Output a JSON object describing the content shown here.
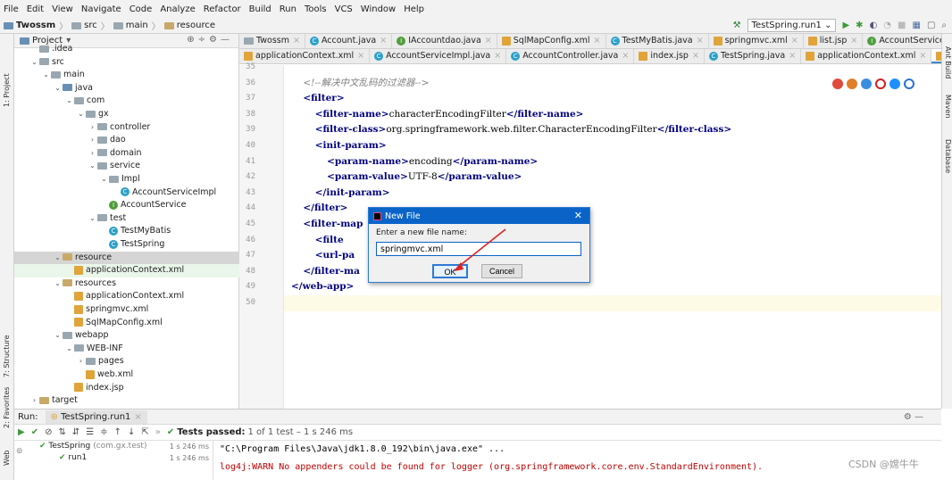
{
  "menu": [
    "File",
    "Edit",
    "View",
    "Navigate",
    "Code",
    "Analyze",
    "Refactor",
    "Build",
    "Run",
    "Tools",
    "VCS",
    "Window",
    "Help"
  ],
  "breadcrumb": [
    "Twossm",
    "src",
    "main",
    "resource"
  ],
  "run_config": "TestSpring.run1",
  "left_strip": {
    "project": "1: Project",
    "structure": "7: Structure",
    "favorites": "2: Favorites",
    "web": "Web"
  },
  "right_strip": {
    "ant": "Ant Build",
    "maven": "Maven",
    "database": "Database"
  },
  "project_panel_title": "Project",
  "tree": [
    {
      "label": ".idea",
      "depth": 1,
      "icon": "folder",
      "chev": ""
    },
    {
      "label": "src",
      "depth": 1,
      "icon": "folder",
      "chev": "v"
    },
    {
      "label": "main",
      "depth": 2,
      "icon": "folder",
      "chev": "v"
    },
    {
      "label": "java",
      "depth": 3,
      "icon": "folder-blue",
      "chev": "v"
    },
    {
      "label": "com",
      "depth": 4,
      "icon": "folder",
      "chev": "v"
    },
    {
      "label": "gx",
      "depth": 5,
      "icon": "folder",
      "chev": "v"
    },
    {
      "label": "controller",
      "depth": 6,
      "icon": "folder",
      "chev": ">"
    },
    {
      "label": "dao",
      "depth": 6,
      "icon": "folder",
      "chev": ">"
    },
    {
      "label": "domain",
      "depth": 6,
      "icon": "folder",
      "chev": ">"
    },
    {
      "label": "service",
      "depth": 6,
      "icon": "folder",
      "chev": "v"
    },
    {
      "label": "Impl",
      "depth": 7,
      "icon": "folder",
      "chev": "v"
    },
    {
      "label": "AccountServiceImpl",
      "depth": 8,
      "icon": "class",
      "chev": ""
    },
    {
      "label": "AccountService",
      "depth": 7,
      "icon": "interface",
      "chev": ""
    },
    {
      "label": "test",
      "depth": 6,
      "icon": "folder",
      "chev": "v"
    },
    {
      "label": "TestMyBatis",
      "depth": 7,
      "icon": "class",
      "chev": ""
    },
    {
      "label": "TestSpring",
      "depth": 7,
      "icon": "class",
      "chev": ""
    },
    {
      "label": "resource",
      "depth": 3,
      "icon": "folder-res",
      "chev": "v",
      "state": "sel"
    },
    {
      "label": "applicationContext.xml",
      "depth": 4,
      "icon": "xml",
      "chev": "",
      "state": "hl"
    },
    {
      "label": "resources",
      "depth": 3,
      "icon": "folder-res",
      "chev": "v"
    },
    {
      "label": "applicationContext.xml",
      "depth": 4,
      "icon": "xml",
      "chev": ""
    },
    {
      "label": "springmvc.xml",
      "depth": 4,
      "icon": "xml",
      "chev": ""
    },
    {
      "label": "SqlMapConfig.xml",
      "depth": 4,
      "icon": "xml",
      "chev": ""
    },
    {
      "label": "webapp",
      "depth": 3,
      "icon": "folder",
      "chev": "v"
    },
    {
      "label": "WEB-INF",
      "depth": 4,
      "icon": "folder",
      "chev": "v"
    },
    {
      "label": "pages",
      "depth": 5,
      "icon": "folder",
      "chev": ">"
    },
    {
      "label": "web.xml",
      "depth": 5,
      "icon": "xml",
      "chev": ""
    },
    {
      "label": "index.jsp",
      "depth": 4,
      "icon": "xml",
      "chev": ""
    },
    {
      "label": "target",
      "depth": 1,
      "icon": "folder-res",
      "chev": ">"
    }
  ],
  "tabs_row1": [
    "Twossm",
    "Account.java",
    "IAccountdao.java",
    "SqlMapConfig.xml",
    "TestMyBatis.java",
    "springmvc.xml",
    "list.jsp",
    "AccountService.java"
  ],
  "tabs_row2": [
    "applicationContext.xml",
    "AccountServiceImpl.java",
    "AccountController.java",
    "index.jsp",
    "TestSpring.java",
    "applicationContext.xml",
    "web.xml"
  ],
  "code_lines": [
    {
      "n": "35",
      "html": ""
    },
    {
      "n": "36",
      "html": "    <span class='cm'>&lt;!--解决中文乱码的过滤器--&gt;</span>"
    },
    {
      "n": "37",
      "html": "    <span class='tg'>&lt;filter&gt;</span>"
    },
    {
      "n": "38",
      "html": "        <span class='tg'>&lt;filter-name&gt;</span>characterEncodingFilter<span class='tg'>&lt;/filter-name&gt;</span>"
    },
    {
      "n": "39",
      "html": "        <span class='tg'>&lt;filter-class&gt;</span>org.springframework.web.filter.CharacterEncodingFilter<span class='tg'>&lt;/filter-class&gt;</span>"
    },
    {
      "n": "40",
      "html": "        <span class='tg'>&lt;init-param&gt;</span>"
    },
    {
      "n": "41",
      "html": "            <span class='tg'>&lt;param-name&gt;</span>encoding<span class='tg'>&lt;/param-name&gt;</span>"
    },
    {
      "n": "42",
      "html": "            <span class='tg'>&lt;param-value&gt;</span>UTF-8<span class='tg'>&lt;/param-value&gt;</span>"
    },
    {
      "n": "43",
      "html": "        <span class='tg'>&lt;/init-param&gt;</span>"
    },
    {
      "n": "44",
      "html": "    <span class='tg'>&lt;/filter&gt;</span>"
    },
    {
      "n": "45",
      "html": "    <span class='tg'>&lt;filter-map</span>"
    },
    {
      "n": "46",
      "html": "        <span class='tg'>&lt;filte</span>                                           <span class='tg'>me&gt;</span>"
    },
    {
      "n": "47",
      "html": "        <span class='tg'>&lt;url-pa</span>"
    },
    {
      "n": "48",
      "html": "    <span class='tg'>&lt;/filter-ma</span>"
    },
    {
      "n": "49",
      "html": "<span class='tg'>&lt;/web-app&gt;</span>"
    },
    {
      "n": "50",
      "html": ""
    }
  ],
  "dialog": {
    "title": "New File",
    "prompt": "Enter a new file name:",
    "value": "springmvc.xml",
    "ok": "OK",
    "cancel": "Cancel"
  },
  "run": {
    "label": "Run:",
    "tab": "TestSpring.run1",
    "status_bold": "Tests passed:",
    "status_rest": "1 of 1 test – 1 s 246 ms",
    "tree": [
      {
        "label": "TestSpring",
        "sub": "(com.gx.test)",
        "time": "1 s 246 ms"
      },
      {
        "label": "run1",
        "sub": "",
        "time": "1 s 246 ms"
      }
    ],
    "console": [
      {
        "text": "\"C:\\Program Files\\Java\\jdk1.8.0_192\\bin\\java.exe\" ...",
        "color": "#000"
      },
      {
        "text": "log4j:WARN No appenders could be found for logger (org.springframework.core.env.StandardEnvironment).",
        "color": "#c00000"
      }
    ]
  },
  "watermark": "CSDN @嫦牛牛",
  "colors": {
    "accent": "#0a64c8",
    "tag": "#000080",
    "comment": "#808080",
    "error": "#c00000"
  }
}
